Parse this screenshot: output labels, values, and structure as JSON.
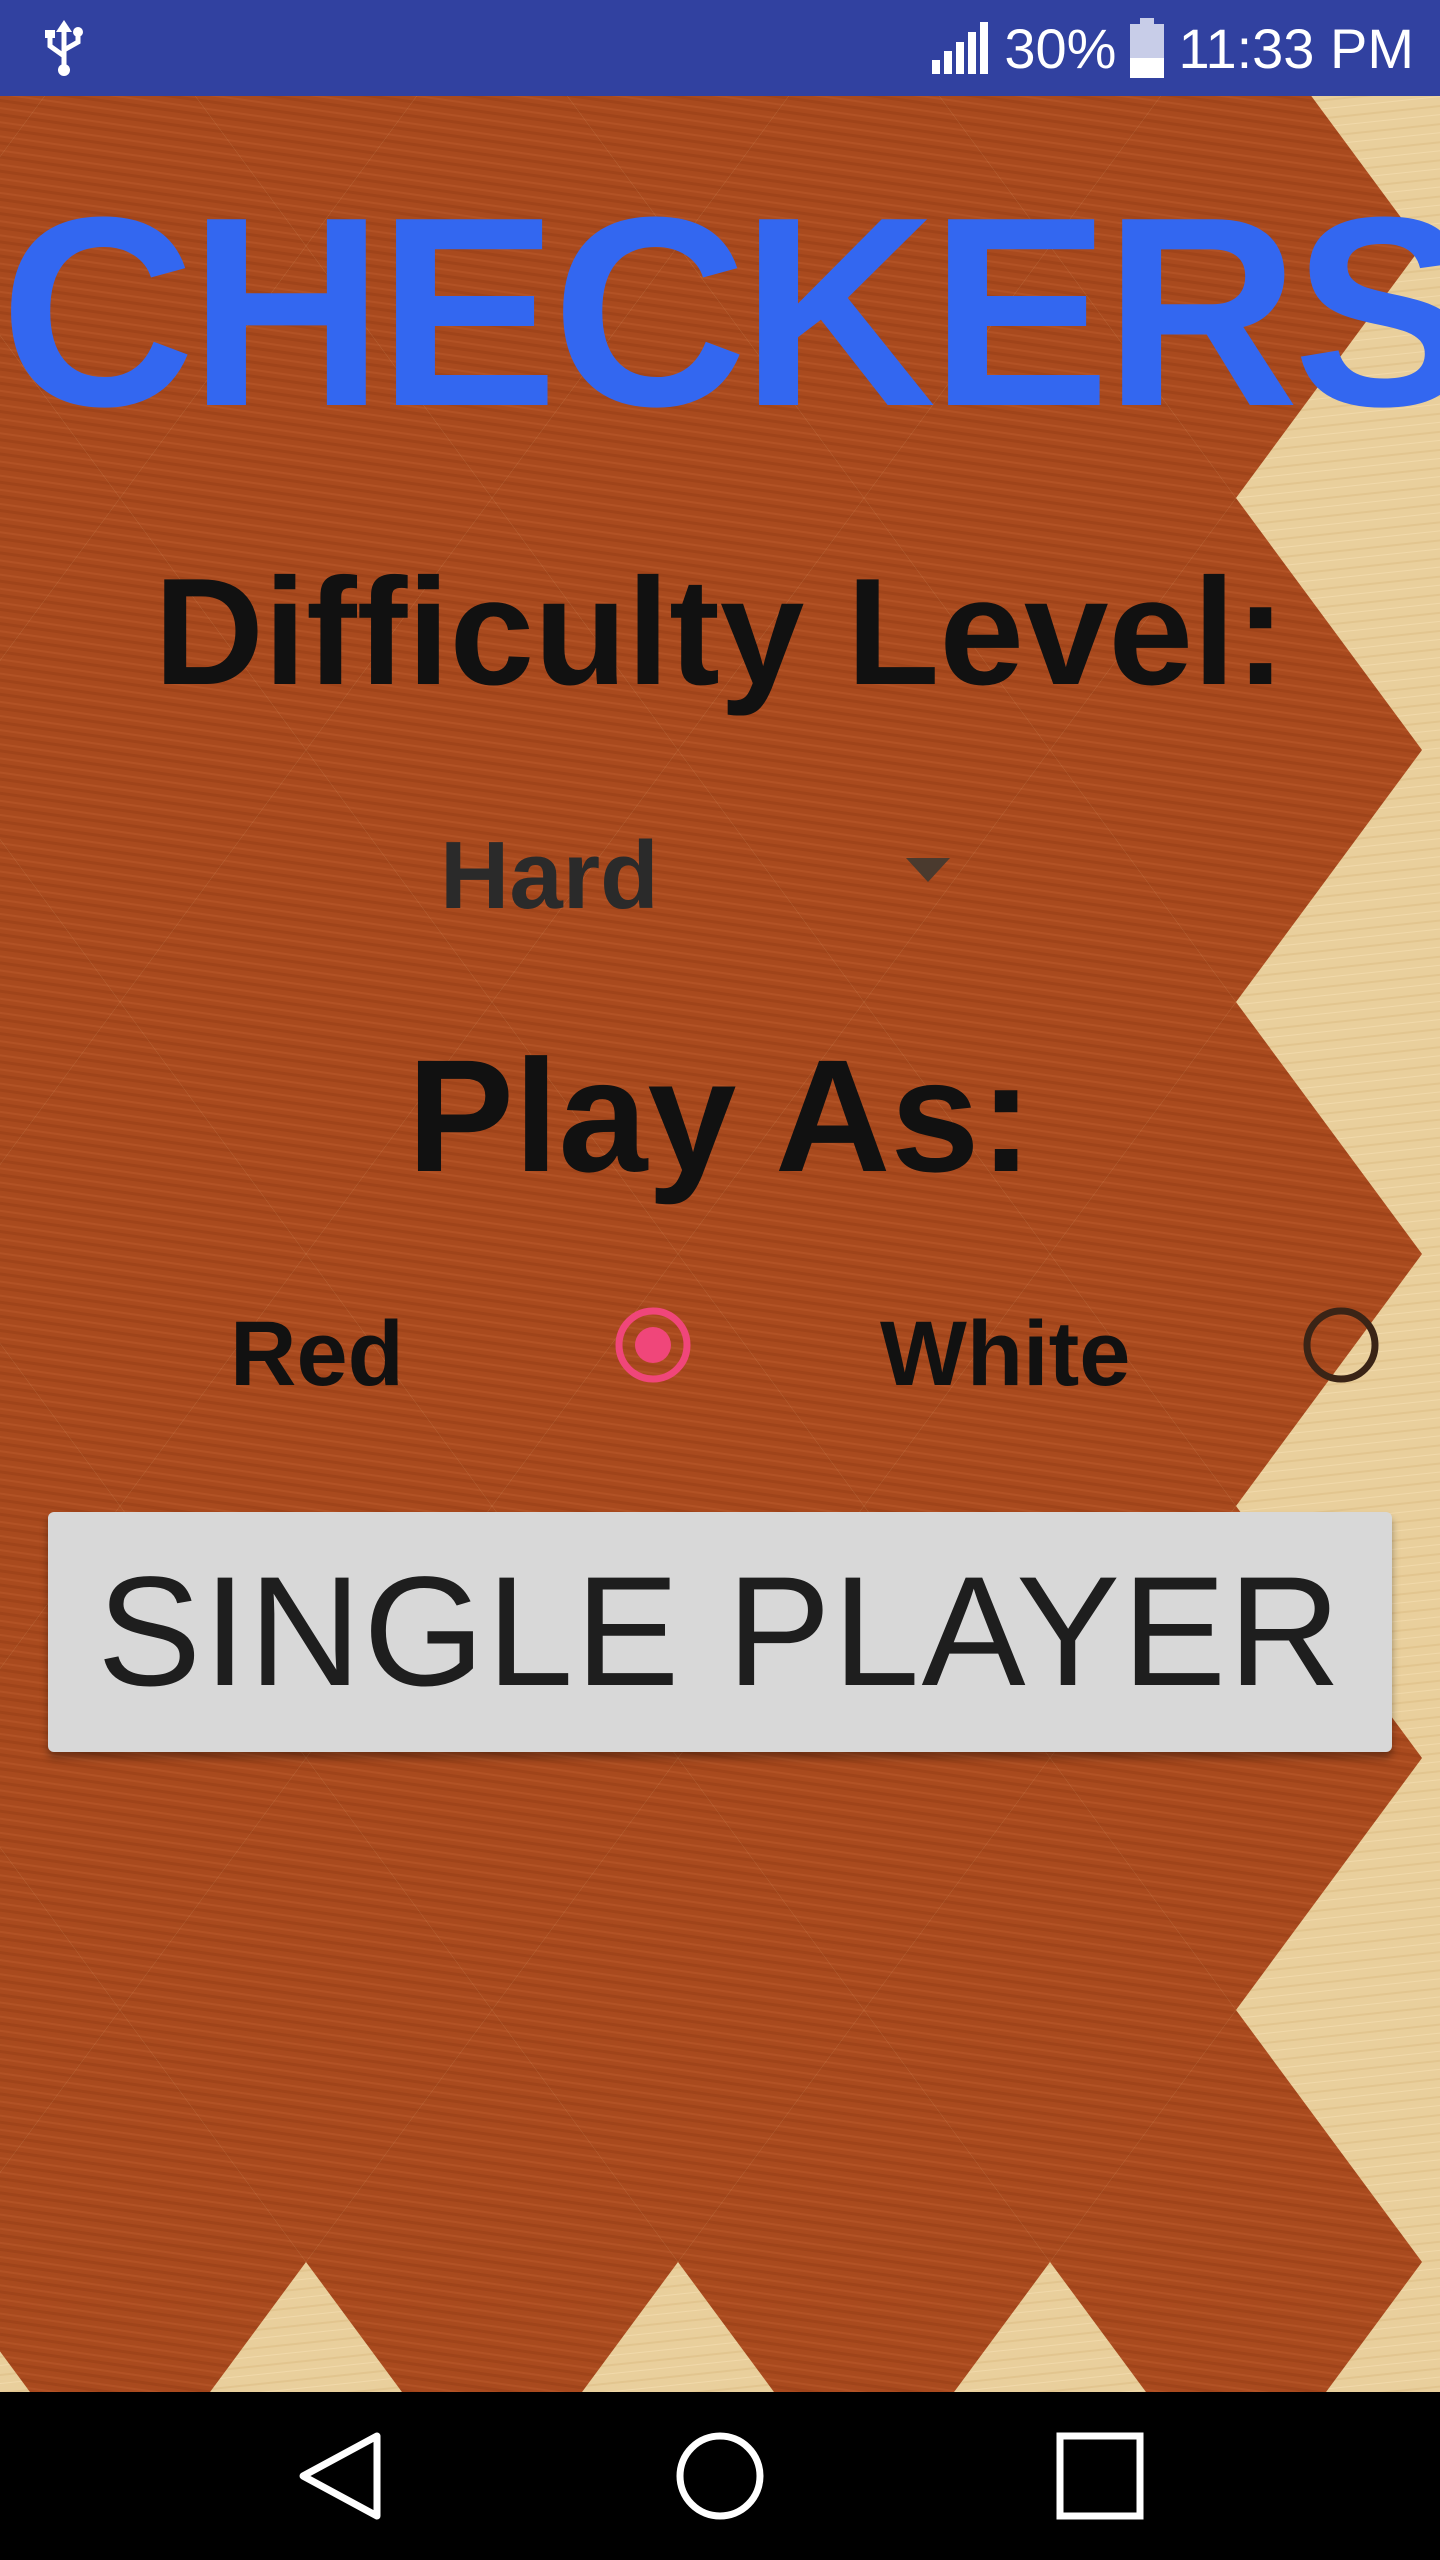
{
  "status_bar": {
    "battery_percent": "30%",
    "time": "11:33 PM",
    "icons": [
      "usb-icon",
      "signal-icon",
      "battery-icon"
    ],
    "background_color": "#3141a0"
  },
  "app": {
    "title": "CHECKERS",
    "title_color": "#3367f0"
  },
  "difficulty": {
    "label": "Difficulty Level:",
    "selected_value": "Hard",
    "dropdown_icon": "dropdown-arrow-icon"
  },
  "play_as": {
    "label": "Play As:",
    "options": [
      {
        "label": "Red",
        "selected": true
      },
      {
        "label": "White",
        "selected": false
      }
    ],
    "selected_color": "#f0467a",
    "unselected_color": "#3a2416"
  },
  "actions": {
    "single_player_label": "SINGLE PLAYER",
    "button_color": "#d8d8d8"
  },
  "nav_bar": {
    "icons": [
      "back-icon",
      "home-icon",
      "recent-apps-icon"
    ]
  },
  "board": {
    "dark_wood_color": "#a94a1e",
    "light_wood_color": "#e9cf9c"
  }
}
